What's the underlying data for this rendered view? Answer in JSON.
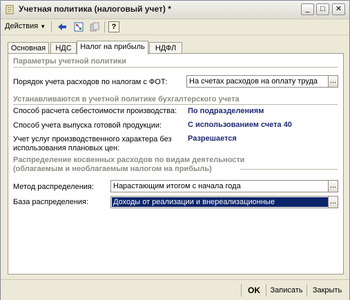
{
  "window": {
    "title": "Учетная политика (налоговый учет) *",
    "minimize": "_",
    "maximize": "□",
    "close": "✕"
  },
  "toolbar": {
    "actions_label": "Действия",
    "help_label": "?"
  },
  "tabs": [
    {
      "label": "Основная",
      "active": false
    },
    {
      "label": "НДС",
      "active": false
    },
    {
      "label": "Налог на прибыль",
      "active": true
    },
    {
      "label": "НДФЛ",
      "active": false
    }
  ],
  "sections": {
    "params": "Параметры учетной политики",
    "accounting": "Устанавливаются в учетной политике бухгалтерского учета",
    "indirect_line1": "Распределение косвенных расходов по видам деятельности",
    "indirect_line2": "(облагаемым и необлагаемым налогом на прибыль)"
  },
  "fot": {
    "label": "Порядок учета расходов по налогам с ФОТ:",
    "value": "На счетах расходов на оплату труда"
  },
  "accounting_rows": [
    {
      "label": "Способ расчета себестоимости производства:",
      "value": "По подразделениям"
    },
    {
      "label": "Способ учета выпуска готовой продукции:",
      "value": "С использованием счета 40"
    },
    {
      "label_line1": "Учет услуг производственного характера без",
      "label_line2": "использования плановых цен:",
      "value": "Разрешается"
    }
  ],
  "distribution": {
    "method_label": "Метод распределения:",
    "method_value": "Нарастающим итогом с начала года",
    "base_label": "База распределения:",
    "base_value": "Доходы от реализации и внереализационные"
  },
  "footer": {
    "ok": "OK",
    "save": "Записать",
    "close": "Закрыть"
  },
  "colors": {
    "value_text": "#1f2a72",
    "selection": "#0a246a",
    "section_text": "#8d8b84"
  }
}
